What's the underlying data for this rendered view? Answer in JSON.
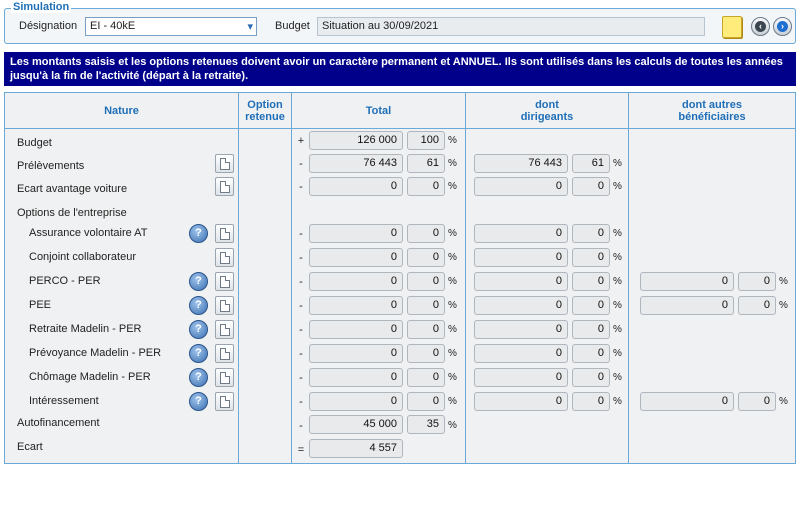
{
  "simulation": {
    "group_title": "Simulation",
    "designation_label": "Désignation",
    "designation_value": "EI - 40kE",
    "budget_label": "Budget",
    "budget_value": "Situation au 30/09/2021"
  },
  "banner": {
    "text": "Les montants saisis et les options retenues doivent avoir un caractère permanent et ANNUEL. Ils sont utilisés dans les calculs de toutes les années jusqu'à la fin de l'activité (départ à la retraite)."
  },
  "columns": {
    "nature": "Nature",
    "option_line1": "Option",
    "option_line2": "retenue",
    "total": "Total",
    "dirigeants_line1": "dont",
    "dirigeants_line2": "dirigeants",
    "autres_line1": "dont autres",
    "autres_line2": "bénéficiaires"
  },
  "rows": {
    "budget": {
      "label": "Budget",
      "sign": "+",
      "total": "126 000",
      "total_pct": "100",
      "pct_symbol": "%"
    },
    "prelevements": {
      "label": "Prélèvements",
      "sign": "-",
      "total": "76 443",
      "total_pct": "61",
      "dir": "76 443",
      "dir_pct": "61"
    },
    "ecart_voiture": {
      "label": "Ecart avantage voiture",
      "sign": "-",
      "total": "0",
      "total_pct": "0",
      "dir": "0",
      "dir_pct": "0"
    },
    "options_header": {
      "label": "Options de l'entreprise"
    },
    "assurance": {
      "label": "Assurance volontaire AT",
      "sign": "-",
      "total": "0",
      "total_pct": "0",
      "dir": "0",
      "dir_pct": "0"
    },
    "conjoint": {
      "label": "Conjoint collaborateur",
      "sign": "-",
      "total": "0",
      "total_pct": "0",
      "dir": "0",
      "dir_pct": "0"
    },
    "perco": {
      "label": "PERCO - PER",
      "sign": "-",
      "total": "0",
      "total_pct": "0",
      "dir": "0",
      "dir_pct": "0",
      "aut": "0",
      "aut_pct": "0"
    },
    "pee": {
      "label": "PEE",
      "sign": "-",
      "total": "0",
      "total_pct": "0",
      "dir": "0",
      "dir_pct": "0",
      "aut": "0",
      "aut_pct": "0"
    },
    "retraite": {
      "label": "Retraite Madelin - PER",
      "sign": "-",
      "total": "0",
      "total_pct": "0",
      "dir": "0",
      "dir_pct": "0"
    },
    "prevoyance": {
      "label": "Prévoyance Madelin - PER",
      "sign": "-",
      "total": "0",
      "total_pct": "0",
      "dir": "0",
      "dir_pct": "0"
    },
    "chomage": {
      "label": "Chômage Madelin - PER",
      "sign": "-",
      "total": "0",
      "total_pct": "0",
      "dir": "0",
      "dir_pct": "0"
    },
    "interessement": {
      "label": "Intéressement",
      "sign": "-",
      "total": "0",
      "total_pct": "0",
      "dir": "0",
      "dir_pct": "0",
      "aut": "0",
      "aut_pct": "0"
    },
    "autofinancement": {
      "label": "Autofinancement",
      "sign": "-",
      "total": "45 000",
      "total_pct": "35"
    },
    "ecart": {
      "label": "Ecart",
      "sign": "=",
      "total": "4 557"
    }
  },
  "icons": {
    "help": "?",
    "dropdown": "▾",
    "prev": "‹",
    "next": "›"
  },
  "colors": {
    "banner_bg": "#00008b",
    "header_text": "#1f6fb8",
    "border": "#6aa9d8"
  }
}
